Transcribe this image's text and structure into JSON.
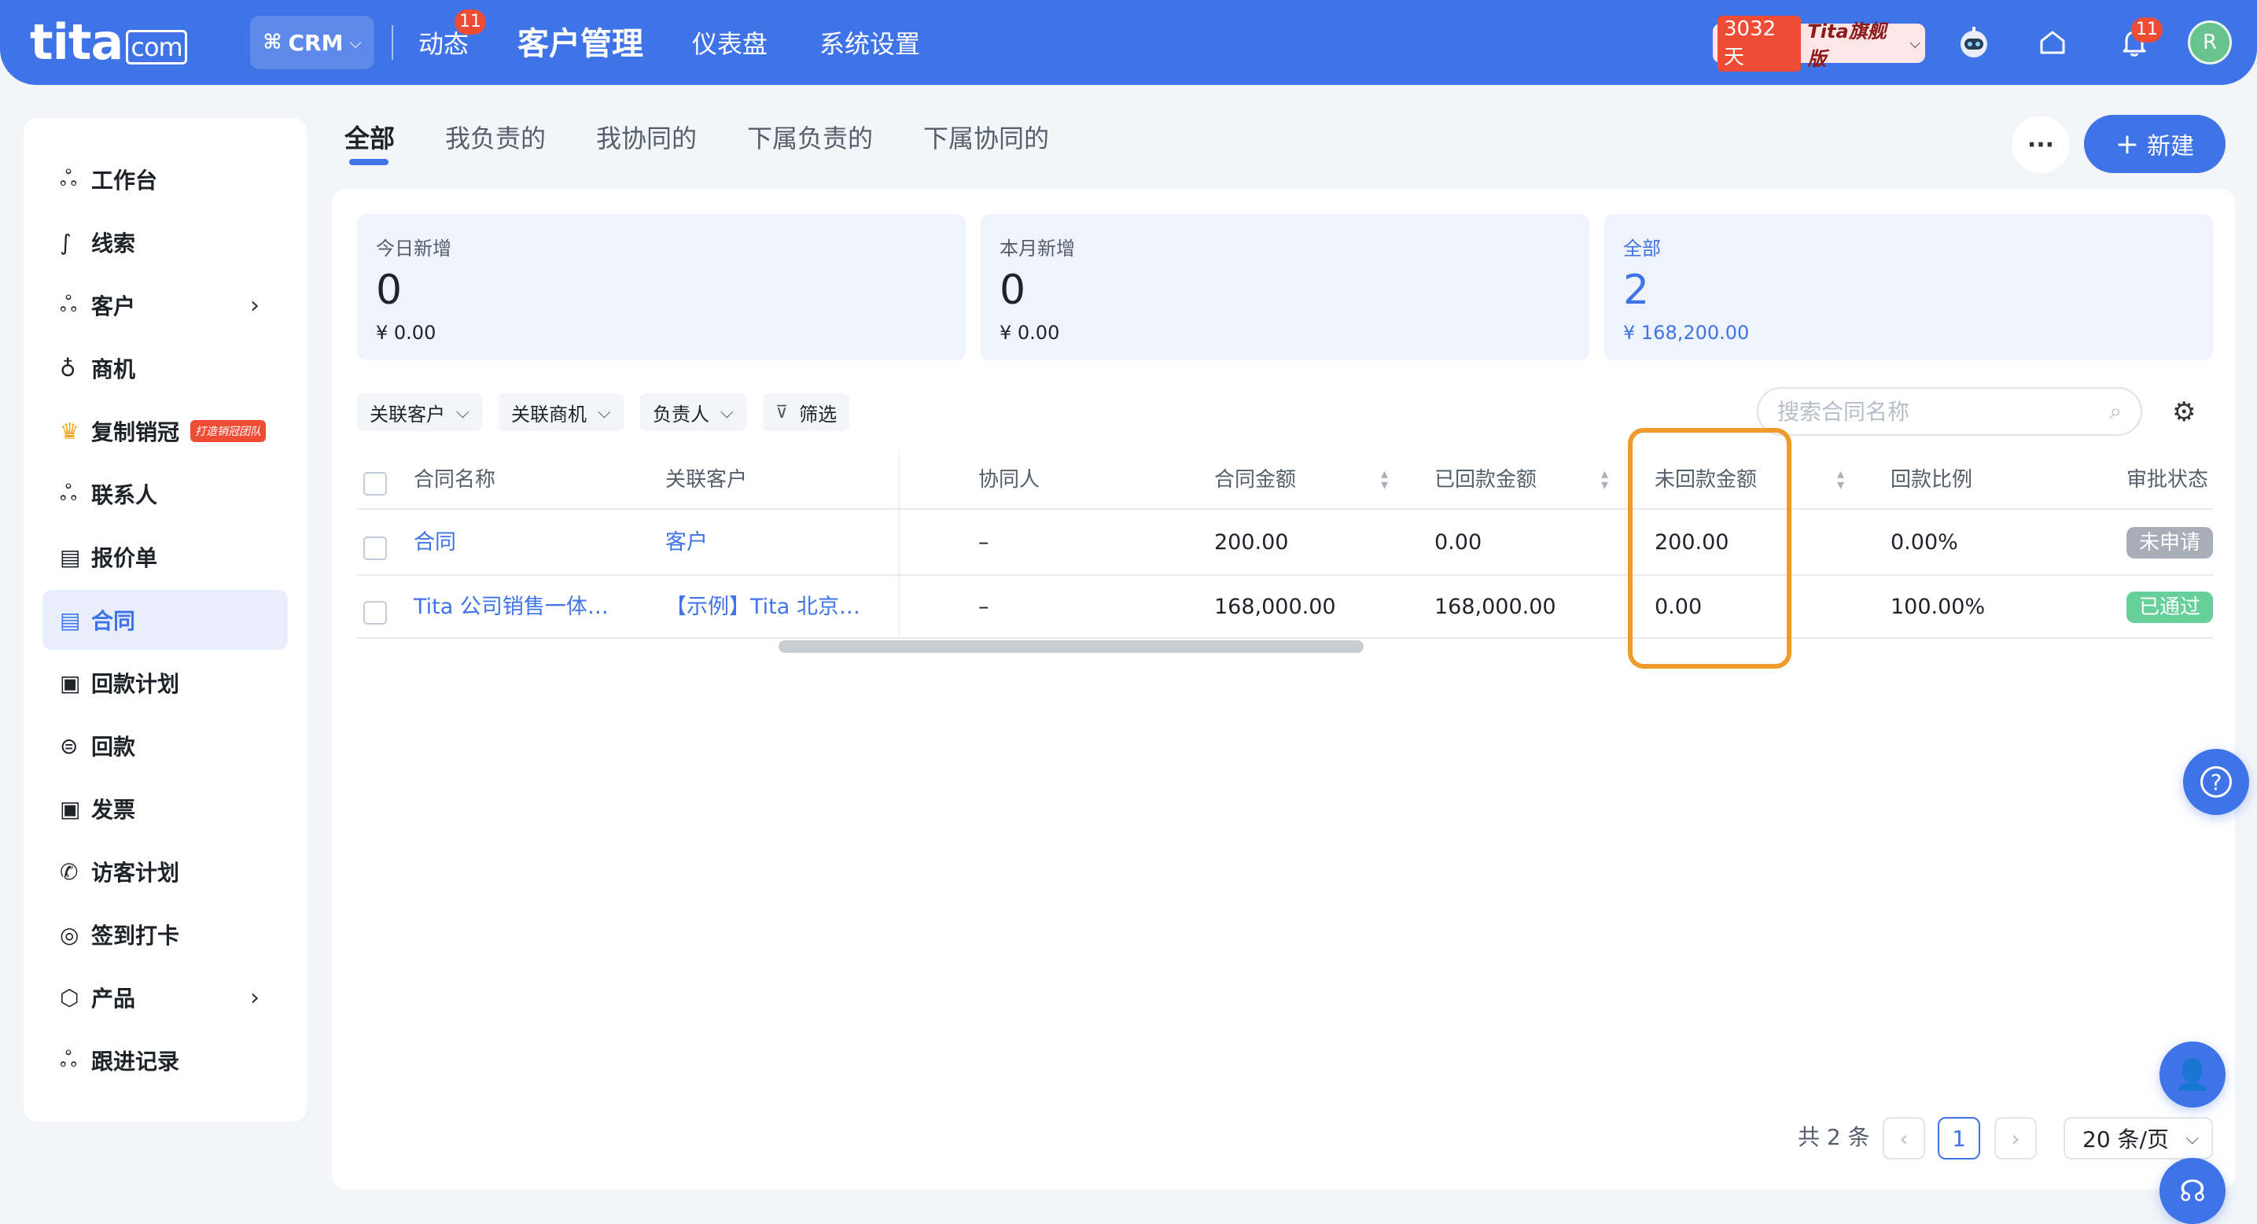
{
  "header": {
    "logo": "tita",
    "logo_suffix": "com",
    "app_switcher": "CRM",
    "nav": [
      {
        "label": "动态",
        "badge": "11"
      },
      {
        "label": "客户管理"
      },
      {
        "label": "仪表盘"
      },
      {
        "label": "系统设置"
      }
    ],
    "trial_days": "3032天",
    "edition": "Tita旗舰版",
    "notification_badge": "11",
    "avatar_initial": "R"
  },
  "sidebar": {
    "items": [
      {
        "label": "工作台",
        "icon": "users-icon"
      },
      {
        "label": "线索",
        "icon": "route-icon"
      },
      {
        "label": "客户",
        "icon": "users-icon",
        "has_children": true
      },
      {
        "label": "商机",
        "icon": "bulb-icon"
      },
      {
        "label": "复制销冠",
        "icon": "crown-icon",
        "promo": "打造销冠团队"
      },
      {
        "label": "联系人",
        "icon": "users-icon"
      },
      {
        "label": "报价单",
        "icon": "quote-icon"
      },
      {
        "label": "合同",
        "icon": "contract-icon",
        "active": true
      },
      {
        "label": "回款计划",
        "icon": "calendar-icon"
      },
      {
        "label": "回款",
        "icon": "yen-circle-icon"
      },
      {
        "label": "发票",
        "icon": "invoice-icon"
      },
      {
        "label": "访客计划",
        "icon": "phone-icon"
      },
      {
        "label": "签到打卡",
        "icon": "location-icon"
      },
      {
        "label": "产品",
        "icon": "box-icon",
        "has_children": true
      },
      {
        "label": "跟进记录",
        "icon": "users-icon"
      }
    ]
  },
  "tabs": [
    "全部",
    "我负责的",
    "我协同的",
    "下属负责的",
    "下属协同的"
  ],
  "active_tab": "全部",
  "actions": {
    "more": "···",
    "new_label": "新建"
  },
  "stats": [
    {
      "label": "今日新增",
      "count": "0",
      "amount": "¥ 0.00"
    },
    {
      "label": "本月新增",
      "count": "0",
      "amount": "¥ 0.00"
    },
    {
      "label": "全部",
      "count": "2",
      "amount": "¥ 168,200.00"
    }
  ],
  "filters": {
    "related_customer": "关联客户",
    "related_opportunity": "关联商机",
    "owner": "负责人",
    "filter": "筛选",
    "search_placeholder": "搜索合同名称"
  },
  "table": {
    "columns": [
      "合同名称",
      "关联客户",
      "协同人",
      "合同金额",
      "已回款金额",
      "未回款金额",
      "回款比例",
      "审批状态"
    ],
    "rows": [
      {
        "name": "合同",
        "customer": "客户",
        "collaborator": "–",
        "amount": "200.00",
        "received": "0.00",
        "unreceived": "200.00",
        "ratio": "0.00%",
        "status": "未申请",
        "status_color": "#a8aeb8"
      },
      {
        "name": "Tita 公司销售一体…",
        "customer": "【示例】Tita 北京…",
        "collaborator": "–",
        "amount": "168,000.00",
        "received": "168,000.00",
        "unreceived": "0.00",
        "ratio": "100.00%",
        "status": "已通过",
        "status_color": "#67cf9a"
      }
    ]
  },
  "pagination": {
    "total": "共 2 条",
    "current": "1",
    "page_size": "20 条/页"
  },
  "colors": {
    "primary": "#3f73e8",
    "highlight": "#f09a2c",
    "badge": "#ef4c36"
  }
}
